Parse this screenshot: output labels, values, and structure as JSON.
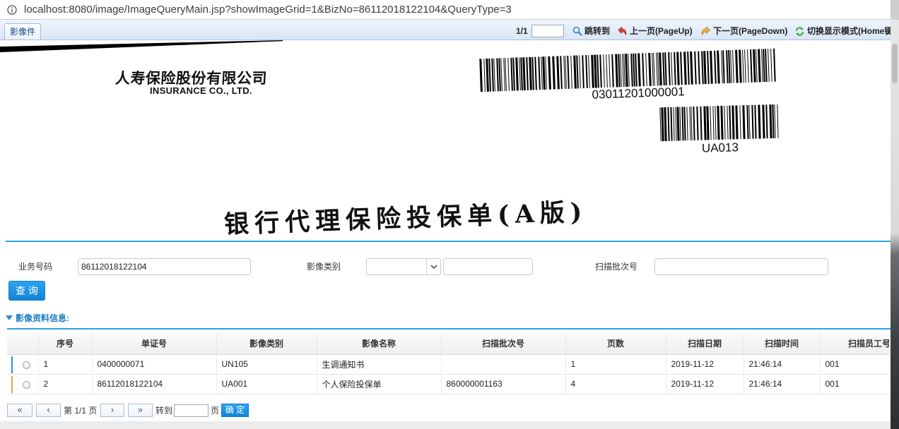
{
  "colors": {
    "accent": "#2ea0e3",
    "section_title": "#1c7cc4",
    "row_marker_1": "#2a8fdc",
    "row_marker_2": "#eaa23a"
  },
  "address_bar": {
    "icon": "info-icon",
    "url": "localhost:8080/image/ImageQueryMain.jsp?showImageGrid=1&BizNo=86112018122104&QueryType=3"
  },
  "viewer_toolbar": {
    "tab_label": "影像件",
    "page_indicator": "1/1",
    "jump_input_value": "",
    "jump": {
      "icon": "search-icon",
      "label": "跳转到"
    },
    "prev": {
      "icon": "prev-page-icon",
      "label": "上一页(PageUp)"
    },
    "next": {
      "icon": "next-page-icon",
      "label": "下一页(PageDown)"
    },
    "toggle": {
      "icon": "toggle-mode-icon",
      "label": "切换显示模式(Home键"
    }
  },
  "document_image": {
    "company_cn": "人寿保险股份有限公司",
    "company_en": "INSURANCE CO., LTD.",
    "barcode_main_number": "03011201000001",
    "barcode_type_number": "UA013",
    "form_title": "银行代理保险投保单(A版)"
  },
  "query_form": {
    "biz_no": {
      "label": "业务号码",
      "value": "86112018122104"
    },
    "image_type": {
      "label": "影像类别",
      "selected": "",
      "text_value": ""
    },
    "scan_batch": {
      "label": "扫描批次号",
      "value": ""
    },
    "query_button": "查 询"
  },
  "results": {
    "section_title": "影像资料信息:",
    "columns": [
      "序号",
      "单证号",
      "影像类别",
      "影像名称",
      "扫描批次号",
      "页数",
      "扫描日期",
      "扫描时间",
      "扫描员工号"
    ],
    "rows": [
      [
        "1",
        "0400000071",
        "UN105",
        "生调通知书",
        "",
        "1",
        "2019-11-12",
        "21:46:14",
        "001"
      ],
      [
        "2",
        "86112018122104",
        "UA001",
        "个人保险投保单",
        "860000001163",
        "4",
        "2019-11-12",
        "21:46:14",
        "001"
      ]
    ]
  },
  "pagination": {
    "first": "«",
    "prev": "‹",
    "page_text": "第 1/1 页",
    "next": "›",
    "last": "»",
    "goto_label": "转到",
    "goto_value": "",
    "page_suffix": "页",
    "confirm": "确 定"
  }
}
